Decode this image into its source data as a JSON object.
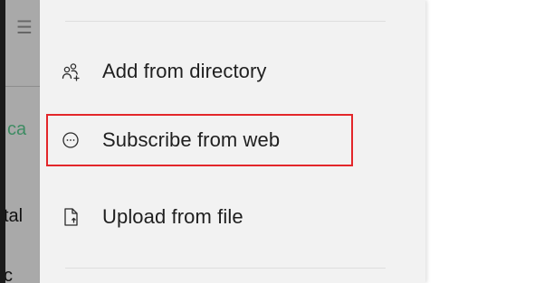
{
  "background_fragments": {
    "top": "☰",
    "middle": "ca",
    "lower": "tal",
    "bottom": "c"
  },
  "menu": {
    "items": [
      {
        "label": "Add from directory",
        "icon": "add-people-icon"
      },
      {
        "label": "Subscribe from web",
        "icon": "subscribe-web-icon"
      },
      {
        "label": "Upload from file",
        "icon": "upload-file-icon"
      }
    ]
  },
  "colors": {
    "highlight": "#e3262a",
    "panel": "#f2f2f2"
  }
}
